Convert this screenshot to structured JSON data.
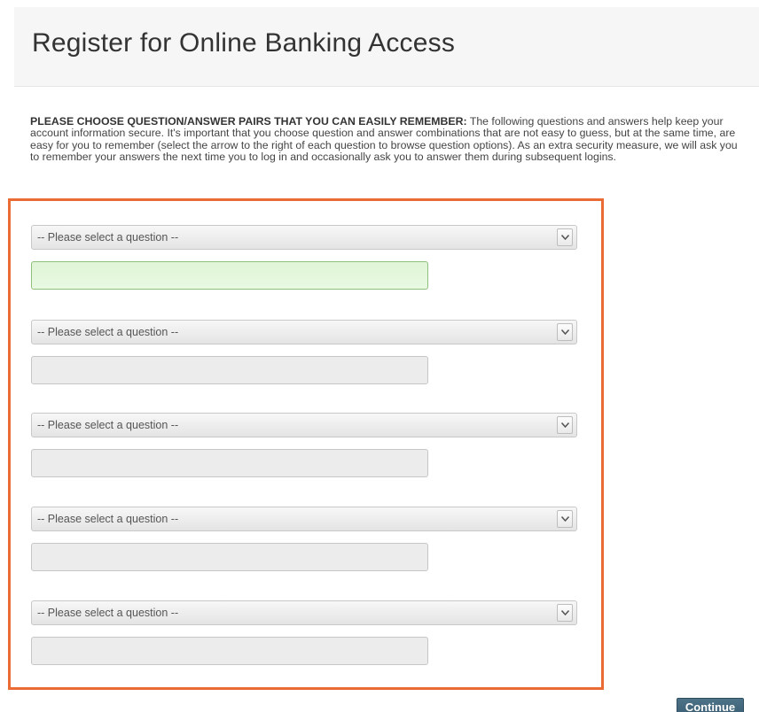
{
  "header": {
    "title": "Register for Online Banking Access"
  },
  "instructions": {
    "lead": "PLEASE CHOOSE QUESTION/ANSWER PAIRS THAT YOU CAN EASILY REMEMBER:",
    "body": "The following questions and answers help keep your account information secure. It's important that you choose question and answer combinations that are not easy to guess, but at the same time, are easy for you to remember (select the arrow to the right of each question to browse question options). As an extra security measure, we will ask you to remember your answers the next time you to log in and occasionally ask you to answer them during subsequent logins."
  },
  "questions": [
    {
      "select_value": "-- Please select a question --",
      "answer_value": ""
    },
    {
      "select_value": "-- Please select a question --",
      "answer_value": ""
    },
    {
      "select_value": "-- Please select a question --",
      "answer_value": ""
    },
    {
      "select_value": "-- Please select a question --",
      "answer_value": ""
    },
    {
      "select_value": "-- Please select a question --",
      "answer_value": ""
    }
  ],
  "actions": {
    "continue_label": "Continue"
  },
  "colors": {
    "highlight_border": "#ea6b33",
    "active_field": "#e3f6db",
    "continue_button": "#436a80"
  },
  "icons": {
    "dropdown": "chevron-down-icon"
  }
}
